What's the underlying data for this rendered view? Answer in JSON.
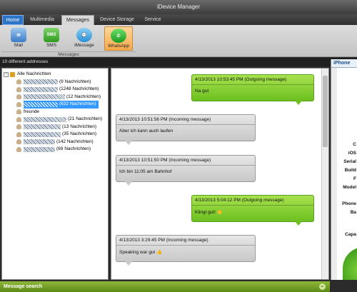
{
  "window": {
    "title": "iDevice Manager"
  },
  "tabs": [
    {
      "label": "Home"
    },
    {
      "label": "Multimedia"
    },
    {
      "label": "Messages"
    },
    {
      "label": "Device Storage"
    },
    {
      "label": "Service"
    }
  ],
  "ribbon": {
    "buttons": [
      {
        "label": "Mail",
        "icon": "mail-icon",
        "badge": ""
      },
      {
        "label": "SMS",
        "icon": "sms-icon",
        "badge": "SMS"
      },
      {
        "label": "iMessage",
        "icon": "imessage-icon",
        "badge": ""
      },
      {
        "label": "WhatsApp",
        "icon": "whatsapp-icon",
        "badge": ""
      }
    ],
    "group_label": "Messages"
  },
  "address_count": "10 different addresses",
  "tree": {
    "root": "Alle Nachrichten",
    "items": [
      {
        "count": "(9 Nachrichten)"
      },
      {
        "count": "(1248 Nachrichten)"
      },
      {
        "count": "(12 Nachrichten)"
      },
      {
        "count": "(632 Nachrichten)"
      },
      {
        "name": "freunde"
      },
      {
        "count": "(21 Nachrichten)"
      },
      {
        "count": "(13 Nachrichten)"
      },
      {
        "count": "(35 Nachrichten)"
      },
      {
        "count": "(142 Nachrichten)"
      },
      {
        "count": "(69 Nachrichten)"
      }
    ]
  },
  "messages": [
    {
      "header": "4/13/2013 10:53:45 PM  (Outgoing message)",
      "text": "Na gut",
      "direction": "out"
    },
    {
      "header": "4/13/2013 10:51:56 PM  (Incoming message)",
      "text": "Aber ich kann auch laufen",
      "direction": "in"
    },
    {
      "header": "4/13/2013 10:51:50 PM  (Incoming message)",
      "text": "Ich bin 11:05 am Bahnhof",
      "direction": "in"
    },
    {
      "header": "4/13/2013 5:04:12 PM  (Outgoing message)",
      "text": "Klingt gut! 👏",
      "direction": "out"
    },
    {
      "header": "4/13/2013 3:29:45 PM  (Incoming message)",
      "text": "Speaking war gut 👍",
      "direction": "in"
    }
  ],
  "right_panel": {
    "tab": "iPhone",
    "labels": [
      "C",
      "iOS",
      "Serial",
      "Build",
      "F",
      "Model",
      "Phone",
      "Ba",
      "Capa"
    ]
  },
  "search": {
    "label": "Message search"
  },
  "colors": {
    "accent": "#2c74c8",
    "outgoing": "#8ed33a",
    "incoming": "#d9d9d9",
    "selection": "#3399ff"
  }
}
